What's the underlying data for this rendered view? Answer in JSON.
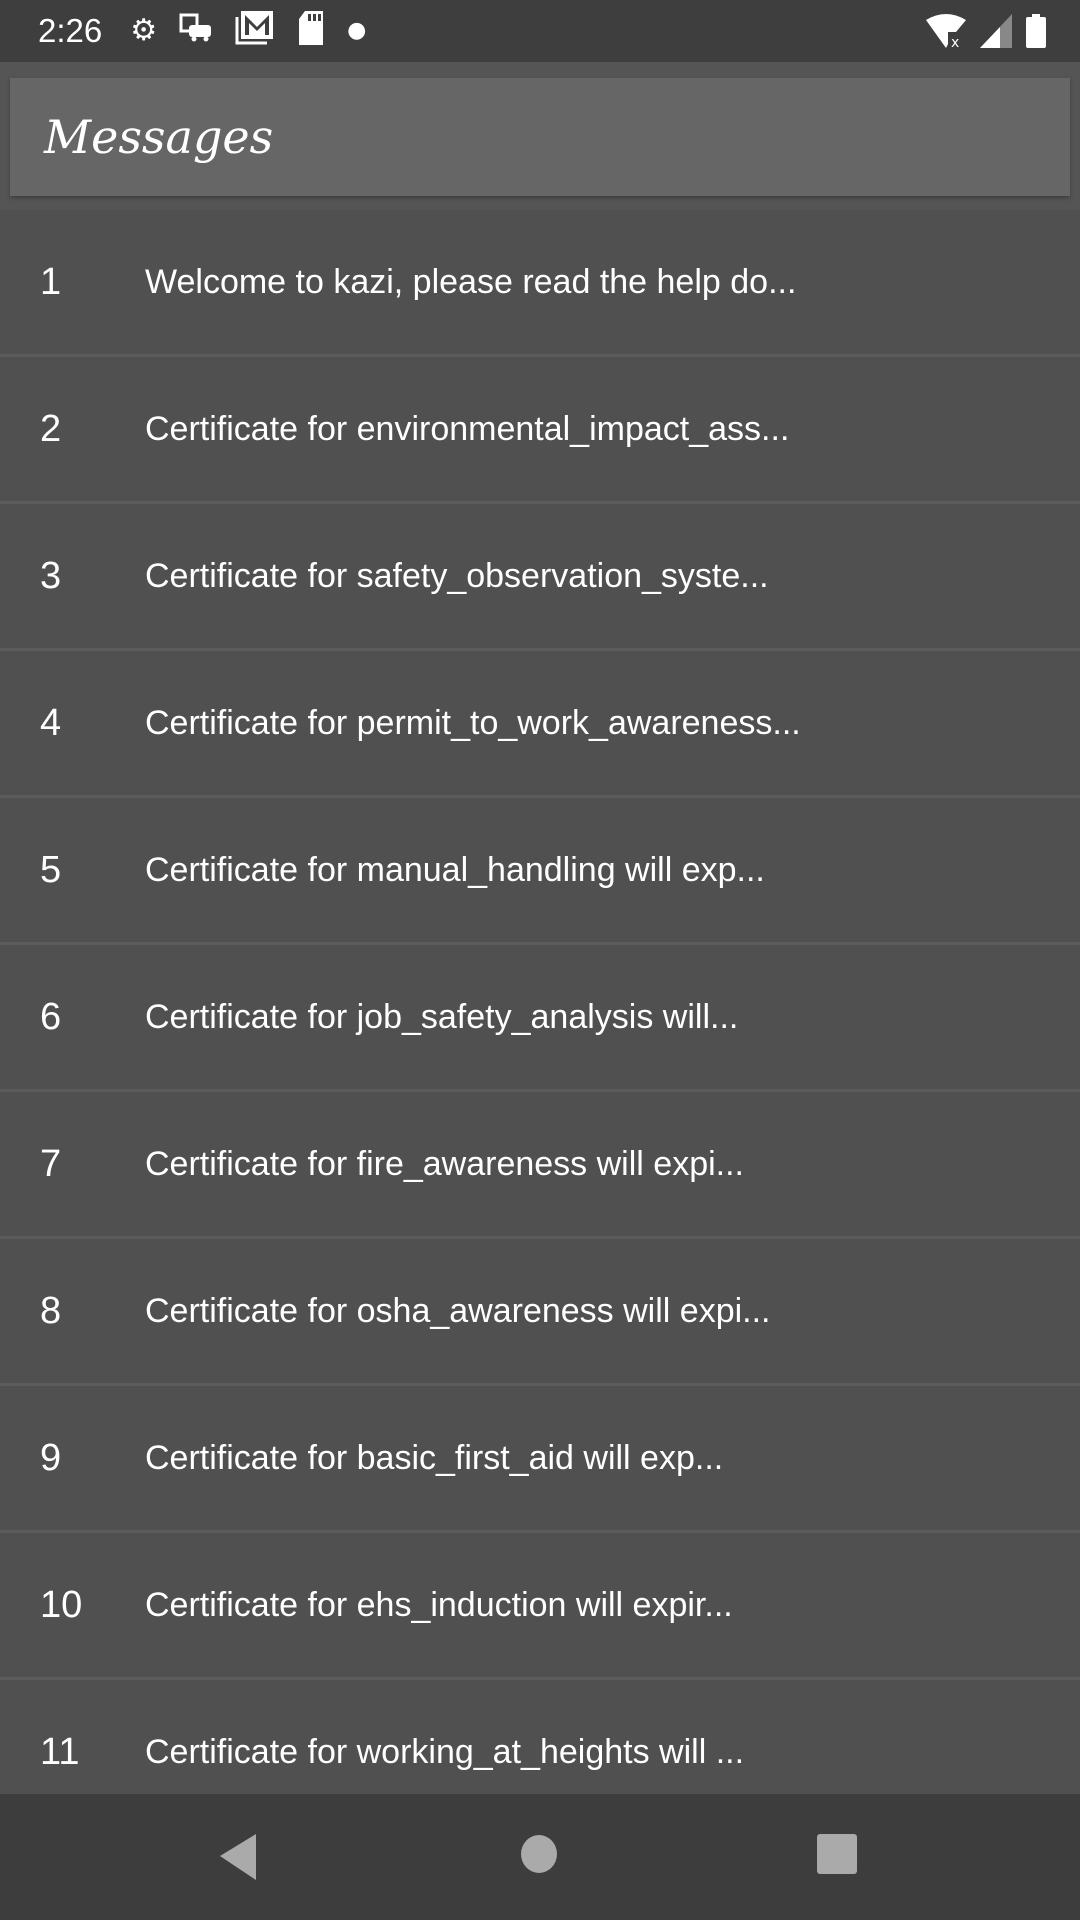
{
  "status_bar": {
    "time": "2:26",
    "left_icons": [
      "settings-icon",
      "car-icon",
      "gmail-icon",
      "sd-card-icon",
      "dot-icon"
    ],
    "right_icons": [
      "wifi-no-internet-icon",
      "signal-icon",
      "battery-icon"
    ]
  },
  "header": {
    "title": "Messages"
  },
  "messages": [
    {
      "index": "1",
      "text": "Welcome to kazi, please read the help do..."
    },
    {
      "index": "2",
      "text": "Certificate for environmental_impact_ass..."
    },
    {
      "index": "3",
      "text": "Certificate for safety_observation_syste..."
    },
    {
      "index": "4",
      "text": "Certificate for permit_to_work_awareness..."
    },
    {
      "index": "5",
      "text": "Certificate for manual_handling will exp..."
    },
    {
      "index": "6",
      "text": "Certificate for job_safety_analysis will..."
    },
    {
      "index": "7",
      "text": "Certificate for fire_awareness will expi..."
    },
    {
      "index": "8",
      "text": "Certificate for osha_awareness will expi..."
    },
    {
      "index": "9",
      "text": "Certificate for basic_first_aid will exp..."
    },
    {
      "index": "10",
      "text": "Certificate for ehs_induction will expir..."
    },
    {
      "index": "11",
      "text": "Certificate for working_at_heights will ..."
    }
  ],
  "nav_bar": {
    "buttons": [
      "back",
      "home",
      "recents"
    ]
  }
}
